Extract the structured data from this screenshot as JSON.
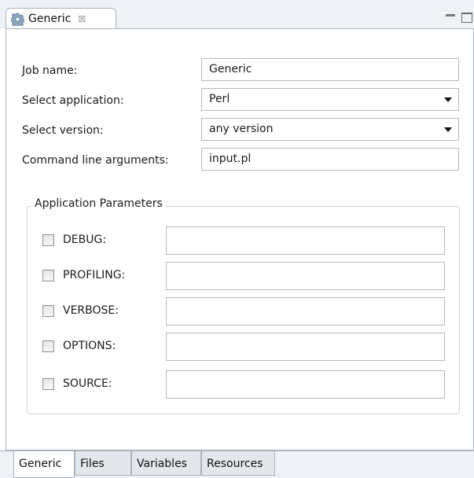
{
  "view": {
    "tab_title": "Generic",
    "tab_close_glyph": "☒",
    "icon": "gear-icon"
  },
  "form": {
    "job_name": {
      "label": "Job name:",
      "value": "Generic"
    },
    "application": {
      "label": "Select application:",
      "value": "Perl"
    },
    "version": {
      "label": "Select version:",
      "value": "any version"
    },
    "command_line": {
      "label": "Command line arguments:",
      "value": "input.pl"
    }
  },
  "app_params": {
    "title": "Application Parameters",
    "params": [
      {
        "label": "DEBUG:",
        "checked": false,
        "value": ""
      },
      {
        "label": "PROFILING:",
        "checked": false,
        "value": ""
      },
      {
        "label": "VERBOSE:",
        "checked": false,
        "value": ""
      },
      {
        "label": "OPTIONS:",
        "checked": false,
        "value": ""
      },
      {
        "label": "SOURCE:",
        "checked": false,
        "value": ""
      }
    ]
  },
  "bottom_tabs": [
    "Generic",
    "Files",
    "Variables",
    "Resources"
  ],
  "active_bottom_tab": "Generic",
  "colors": {
    "tab_border": "#a9b3bf",
    "gear": "#8aa4c0"
  }
}
